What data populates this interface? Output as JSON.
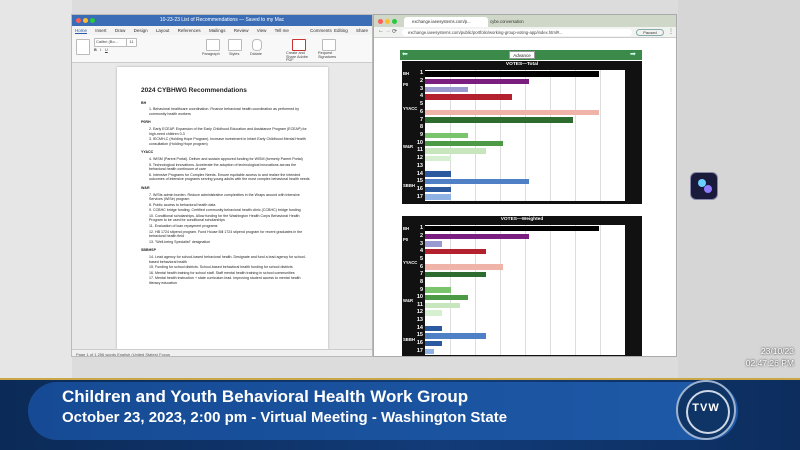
{
  "word": {
    "title": "10-23-23 List of Recommendations — Saved to my Mac",
    "tabs": [
      "Home",
      "Insert",
      "Draw",
      "Design",
      "Layout",
      "References",
      "Mailings",
      "Review",
      "View",
      "Tell me"
    ],
    "ribbon": {
      "font": "Calibri (Bo...",
      "size": "11",
      "paragraph": "Paragraph",
      "styles": "Styles",
      "dictate": "Dictate",
      "create_pdf": "Create and Share Adobe PDF",
      "request_sig": "Request Signatures",
      "comments": "Comments",
      "editing": "Editing",
      "share": "Share"
    },
    "doc": {
      "title": "2024 CYBHWG Recommendations",
      "sections": [
        {
          "heading": "BH",
          "items": [
            "1. Behavioral healthcare coordination. Finance behavioral health coordination as performed by community health workers"
          ]
        },
        {
          "heading": "P0RH",
          "items": [
            "2. Early ECEAP. Expansion of the Early Childhood Education and Assistance Program (ECEAP) for high-need children 0-3",
            "3. IECMH-C (Holding Hope Program). Increase investment in Infant Early Childhood Mental Health consultation (Holding Hope program)"
          ]
        },
        {
          "heading": "YYACC",
          "items": [
            "4. WISM (Parent Portal). Deliver and sustain approved funding for WISM (formerly Parent Portal)",
            "5. Technological innovations. Accelerate the adoption of technological innovations across the behavioral health continuum of care",
            "6. Intensive Programs for Complex Needs. Ensure equitable access to and realize the intended outcomes of intensive programs serving young adults with the most complex behavioral health needs"
          ]
        },
        {
          "heading": "W&R",
          "items": [
            "7. W/Sts admin burden. Reduce administrative complexities in the Wraps around with intensive Services (WISe) program",
            "8. Public access to behavioral health data",
            "9. CCBHC bridge funding. Certified community behavioral health clinic (CCBHC) bridge funding",
            "10. Conditional scholarships. Allow funding for the Washington Health Corps Behavioral Health Program to be used for conditional scholarships",
            "11. Evaluation of loan repayment programs",
            "12. HB 1724 stipend program. Fund House Bill 1724 stipend program for recent graduates in the behavioral health field",
            "13. \"Well-being Specialist\" designation"
          ]
        },
        {
          "heading": "SBBHSP",
          "items": [
            "14. Lead agency for school-based behavioral health. Designate and fund a lead agency for school-based behavioral health",
            "15. Funding for school districts. School-based behavioral health funding for school districts",
            "16. Mental health training for school staff. Staff mental health training in school communities",
            "17. Mental health instruction + state curriculum lead. Improving student access to mental health literacy education"
          ]
        }
      ]
    },
    "status": "Page 1 of 1     256 words     English (United States)     Focus"
  },
  "browser": {
    "tabs": [
      "exchange.iaeesystems.com/p...",
      "cybe.conversation"
    ],
    "url": "exchange.iaeesystems.com/public/portfolio/working-group-voting-app/index.html#...",
    "paused": "Paused",
    "advance_label": "Advance"
  },
  "chart_data": [
    {
      "type": "bar",
      "title": "VOTES—Total",
      "categories": [
        "1",
        "2",
        "3",
        "4",
        "5",
        "6",
        "7",
        "8",
        "9",
        "10",
        "11",
        "12",
        "13",
        "14",
        "15",
        "16",
        "17"
      ],
      "groups": [
        {
          "name": "BH",
          "rows": [
            "1"
          ]
        },
        {
          "name": "P0",
          "rows": [
            "2",
            "3"
          ]
        },
        {
          "name": "YYACC",
          "rows": [
            "4",
            "5",
            "6",
            "7"
          ]
        },
        {
          "name": "W&R",
          "rows": [
            "8",
            "9",
            "10",
            "11",
            "12",
            "13"
          ]
        },
        {
          "name": "SBBH",
          "rows": [
            "14",
            "15",
            "16",
            "17"
          ]
        }
      ],
      "values": [
        20,
        12,
        5,
        10,
        0,
        20,
        17,
        0,
        5,
        9,
        7,
        3,
        0,
        3,
        12,
        3,
        3
      ],
      "colors": [
        "#000000",
        "#7a1f7f",
        "#9a9ad0",
        "#b3202e",
        "#e9a39e",
        "#f0b3a8",
        "#2e6b2e",
        "#a9e3a0",
        "#7bc46e",
        "#4c9a45",
        "#c8e6bd",
        "#d6efd0",
        "#e4f3de",
        "#2d5a9e",
        "#4f7fc4",
        "#2d5a9e",
        "#8db2e3"
      ],
      "xlim": [
        0,
        23
      ]
    },
    {
      "type": "bar",
      "title": "VOTES—Weighted",
      "categories": [
        "1",
        "2",
        "3",
        "4",
        "5",
        "6",
        "7",
        "8",
        "9",
        "10",
        "11",
        "12",
        "13",
        "14",
        "15",
        "16",
        "17"
      ],
      "groups": [
        {
          "name": "BH",
          "rows": [
            "1"
          ]
        },
        {
          "name": "P0",
          "rows": [
            "2",
            "3"
          ]
        },
        {
          "name": "YYACC",
          "rows": [
            "4",
            "5",
            "6",
            "7"
          ]
        },
        {
          "name": "W&R",
          "rows": [
            "8",
            "9",
            "10",
            "11",
            "12",
            "13"
          ]
        },
        {
          "name": "SBBH",
          "rows": [
            "14",
            "15",
            "16",
            "17"
          ]
        }
      ],
      "values": [
        20,
        12,
        2,
        7,
        0,
        9,
        7,
        0,
        3,
        5,
        4,
        2,
        0,
        2,
        7,
        2,
        1
      ],
      "colors": [
        "#000000",
        "#7a1f7f",
        "#9a9ad0",
        "#b3202e",
        "#e9a39e",
        "#f0b3a8",
        "#2e6b2e",
        "#a9e3a0",
        "#7bc46e",
        "#4c9a45",
        "#c8e6bd",
        "#d6efd0",
        "#e4f3de",
        "#2d5a9e",
        "#4f7fc4",
        "#2d5a9e",
        "#8db2e3"
      ],
      "xlim": [
        0,
        23
      ]
    }
  ],
  "timestamp": {
    "date": "23/10/23",
    "time": "02:47:26 PM"
  },
  "lower_third": {
    "title": "Children and Youth Behavioral Health Work Group",
    "subtitle": "October 23, 2023, 2:00 pm - Virtual Meeting - Washington State",
    "logo_text": "TVW"
  }
}
